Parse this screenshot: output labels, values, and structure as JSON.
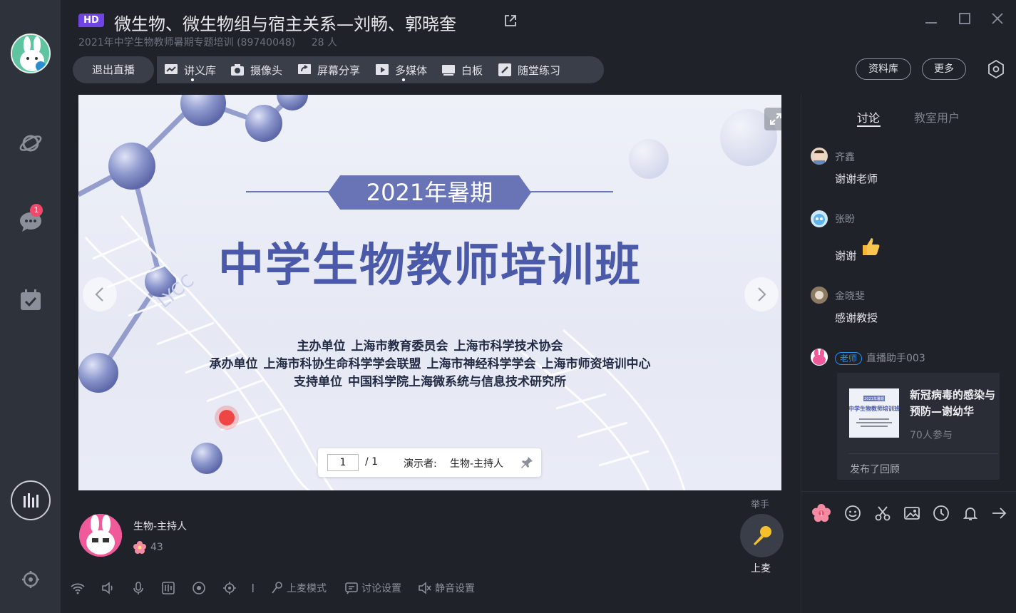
{
  "header": {
    "hd_badge": "HD",
    "title": "微生物、微生物组与宿主关系—刘畅、郭晓奎",
    "course": "2021年中学生物教师暑期专题培训 (89740048)",
    "people": "28 人"
  },
  "sidebar": {
    "chat_badge": "1"
  },
  "toolbar": {
    "exit_label": "退出直播",
    "items": [
      {
        "label": "讲义库",
        "icon": "handout-icon"
      },
      {
        "label": "摄像头",
        "icon": "camera-icon"
      },
      {
        "label": "屏幕分享",
        "icon": "screen-share-icon"
      },
      {
        "label": "多媒体",
        "icon": "media-icon"
      },
      {
        "label": "白板",
        "icon": "whiteboard-icon"
      },
      {
        "label": "随堂练习",
        "icon": "exercise-icon"
      }
    ],
    "library_label": "资料库",
    "more_label": "更多"
  },
  "slide": {
    "banner": "2021年暑期",
    "title": "中学生物教师培训班",
    "org_lines": [
      [
        "主办单位",
        "上海市教育委员会",
        "上海市科学技术协会"
      ],
      [
        "承办单位",
        "上海市科协生命科学学会联盟",
        "上海市神经科学学会",
        "上海市师资培训中心"
      ],
      [
        "支持单位",
        "中国科学院上海微系统与信息技术研究所"
      ]
    ],
    "watermark": "LYCC",
    "page_current": "1",
    "page_total": "/ 1",
    "presenter_label": "演示者:",
    "presenter_name": "生物-主持人"
  },
  "host": {
    "name": "生物-主持人",
    "flowers": "43"
  },
  "mic": {
    "raise_hand": "举手",
    "label": "上麦"
  },
  "controls": {
    "mic_mode": "上麦模式",
    "discussion_settings": "讨论设置",
    "mute_settings": "静音设置"
  },
  "panel": {
    "tabs": [
      "讨论",
      "教室用户"
    ],
    "messages": [
      {
        "name": "齐鑫",
        "text": "谢谢老师"
      },
      {
        "name": "张盼",
        "text": "谢谢"
      },
      {
        "name": "金晓斐",
        "text": "感谢教授"
      }
    ],
    "teacher_badge": "老师",
    "assistant_name": "直播助手003",
    "card": {
      "title": "新冠病毒的感染与预防—谢幼华",
      "thumb_banner": "2021年暑期",
      "thumb_title": "中学生物教师培训班",
      "participants": "70人参与",
      "footer": "发布了回顾"
    },
    "flower_count": "1"
  }
}
